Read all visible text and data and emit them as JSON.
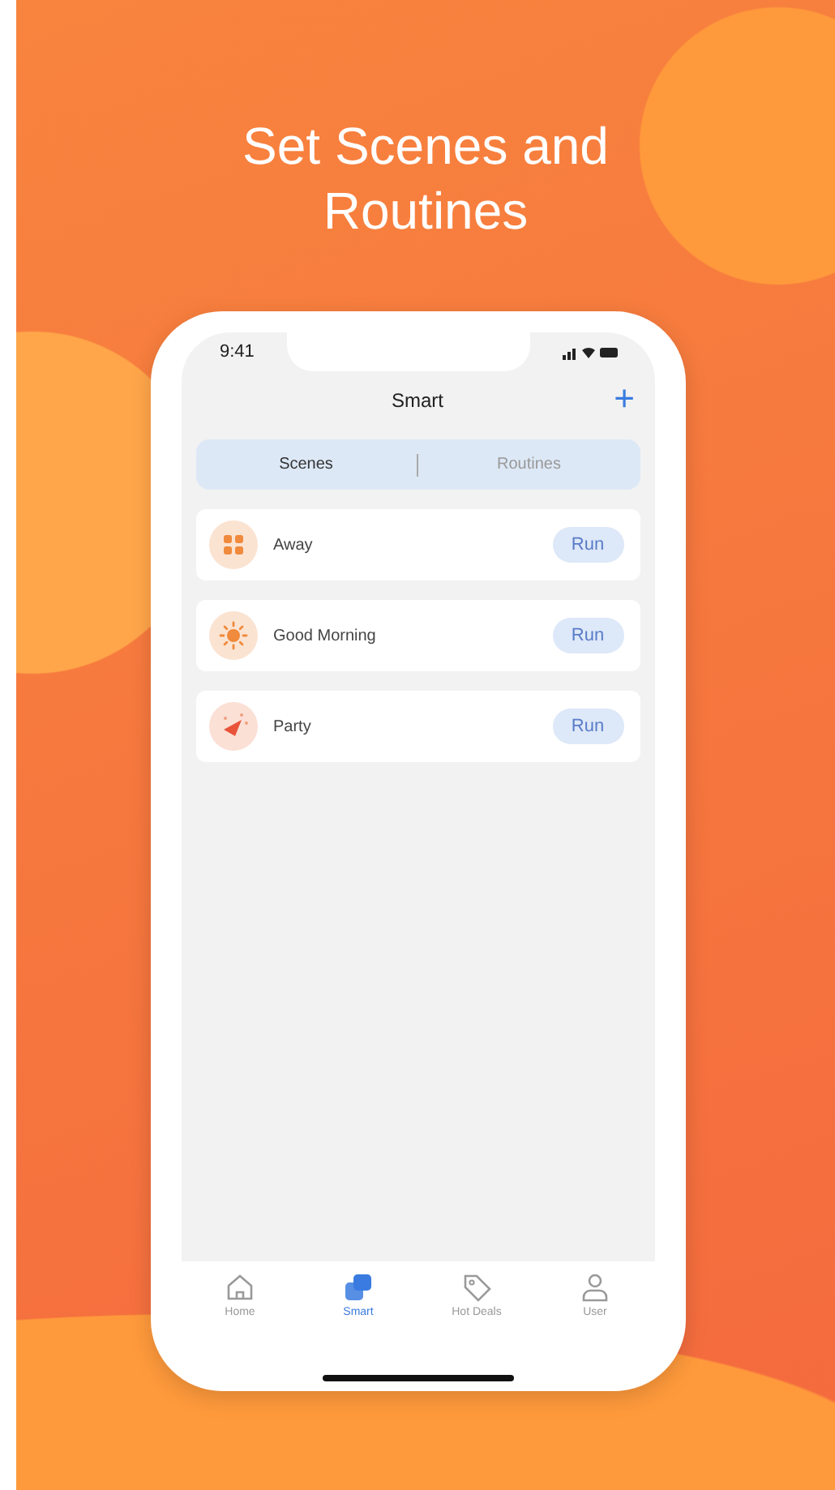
{
  "headline": "Set Scenes and Routines",
  "status_bar": {
    "time": "9:41"
  },
  "nav": {
    "title": "Smart",
    "add": "+"
  },
  "segments": [
    {
      "label": "Scenes",
      "selected": true
    },
    {
      "label": "Routines",
      "selected": false
    }
  ],
  "scenes": [
    {
      "name": "Away",
      "kind": "grid",
      "button": "Run"
    },
    {
      "name": "Good Morning",
      "kind": "sun",
      "button": "Run"
    },
    {
      "name": "Party",
      "kind": "party",
      "button": "Run"
    }
  ],
  "tab_bar": [
    {
      "label": "Home",
      "kind": "home",
      "selected": false
    },
    {
      "label": "Smart",
      "kind": "smart",
      "selected": true
    },
    {
      "label": "Hot Deals",
      "kind": "tag",
      "selected": false
    },
    {
      "label": "User",
      "kind": "user",
      "selected": false
    }
  ]
}
